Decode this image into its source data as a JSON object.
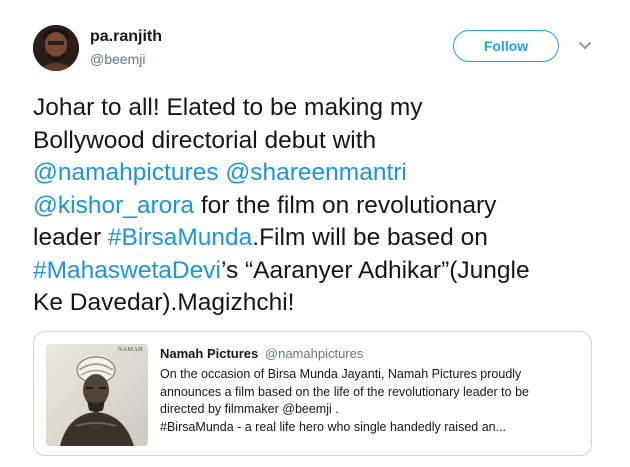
{
  "author": {
    "display_name": "pa.ranjith",
    "handle": "@beemji",
    "avatar_icon": "profile-photo"
  },
  "follow_button": {
    "label": "Follow",
    "color": "#1da1f2"
  },
  "menu": {
    "icon": "chevron-down-icon"
  },
  "tweet": {
    "lines": [
      [
        {
          "text": "Johar to all! Elated to be making my",
          "link": false
        }
      ],
      [
        {
          "text": "Bollywood directorial debut with",
          "link": false
        }
      ],
      [
        {
          "text": "@namahpictures",
          "link": true
        },
        {
          "text": " ",
          "link": false
        },
        {
          "text": "@shareenmantri",
          "link": true
        }
      ],
      [
        {
          "text": "@kishor_arora",
          "link": true
        },
        {
          "text": " for the film on revolutionary",
          "link": false
        }
      ],
      [
        {
          "text": "leader ",
          "link": false
        },
        {
          "text": "#BirsaMunda",
          "link": true
        },
        {
          "text": ".Film will be based on",
          "link": false
        }
      ],
      [
        {
          "text": "#MahaswetaDevi",
          "link": true
        },
        {
          "text": "’s “Aaranyer Adhikar”(Jungle",
          "link": false
        }
      ],
      [
        {
          "text": "Ke Davedar).Magizhchi!",
          "link": false
        }
      ]
    ]
  },
  "quoted_tweet": {
    "name": "Namah Pictures",
    "handle": "@namahpictures",
    "image_caption": "NAMAH",
    "lines": [
      "On the occasion of Birsa Munda Jayanti, Namah Pictures proudly",
      "announces a film based on the life of the revolutionary leader to be",
      "directed by filmmaker @beemji .",
      "#BirsaMunda -  a real life hero who single handedly raised an..."
    ]
  },
  "colors": {
    "link": "#1b95e0",
    "text": "#14171a",
    "secondary": "#657786",
    "border": "#ccd6dd"
  }
}
